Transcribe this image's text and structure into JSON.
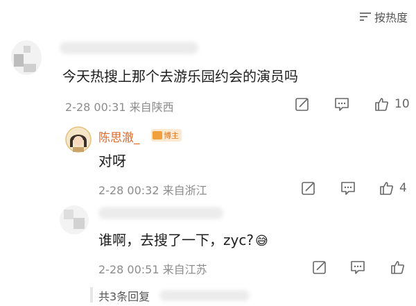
{
  "sort": {
    "label": "按热度"
  },
  "comments": [
    {
      "text": "今天热搜上那个去游乐园约会的演员吗",
      "meta": "2-28 00:31 来自陕西",
      "like_count": "10"
    },
    {
      "username": "陈思澈_",
      "badge": "博主",
      "text": "对呀",
      "meta": "2-28 00:32 来自浙江",
      "like_count": "4"
    },
    {
      "text": "谁啊，去搜了一下，zyc?",
      "emoji": "😅",
      "meta": "2-28 00:51 来自江苏",
      "like_count": ""
    }
  ],
  "reply_summary": {
    "label": "共3条回复"
  },
  "colors": {
    "accent": "#e06a2a",
    "meta": "#8c8c8c",
    "badge_bg": "#fbe9d2"
  }
}
